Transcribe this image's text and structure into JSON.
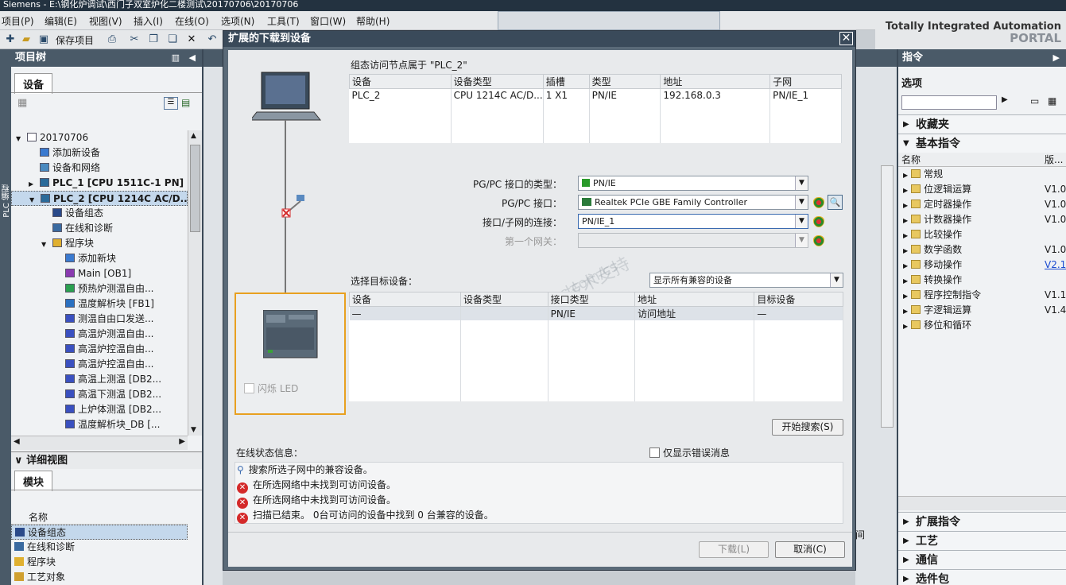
{
  "window": {
    "title": "Siemens - E:\\钢化炉调试\\西门子双室炉化二楼测试\\20170706\\20170706"
  },
  "menu": [
    "项目(P)",
    "编辑(E)",
    "视图(V)",
    "插入(I)",
    "在线(O)",
    "选项(N)",
    "工具(T)",
    "窗口(W)",
    "帮助(H)"
  ],
  "toolbar": {
    "save_label": "保存项目"
  },
  "brand": {
    "line1": "Totally Integrated Automation",
    "line2": "PORTAL"
  },
  "left": {
    "vertical_tab": "PLC 编程",
    "header": "项目树",
    "devices_tab": "设备",
    "tree": [
      {
        "label": "20170706",
        "indent": 0,
        "arrow": "▼",
        "icon": "doc"
      },
      {
        "label": "添加新设备",
        "indent": 1,
        "arrow": "",
        "icon": "add"
      },
      {
        "label": "设备和网络",
        "indent": 1,
        "arrow": "",
        "icon": "net"
      },
      {
        "label": "PLC_1 [CPU 1511C-1 PN]",
        "indent": 1,
        "arrow": "▶",
        "icon": "plc",
        "bold": true
      },
      {
        "label": "PLC_2 [CPU 1214C AC/D...",
        "indent": 1,
        "arrow": "▼",
        "icon": "plc",
        "bold": true,
        "selected": true
      },
      {
        "label": "设备组态",
        "indent": 2,
        "arrow": "",
        "icon": "cfg"
      },
      {
        "label": "在线和诊断",
        "indent": 2,
        "arrow": "",
        "icon": "diag"
      },
      {
        "label": "程序块",
        "indent": 2,
        "arrow": "▼",
        "icon": "folder"
      },
      {
        "label": "添加新块",
        "indent": 3,
        "arrow": "",
        "icon": "add"
      },
      {
        "label": "Main [OB1]",
        "indent": 3,
        "arrow": "",
        "icon": "ob"
      },
      {
        "label": "预热炉测温自由...",
        "indent": 3,
        "arrow": "",
        "icon": "fc"
      },
      {
        "label": "温度解析块 [FB1]",
        "indent": 3,
        "arrow": "",
        "icon": "fb"
      },
      {
        "label": "测温自由口发送...",
        "indent": 3,
        "arrow": "",
        "icon": "db"
      },
      {
        "label": "高温炉测温自由...",
        "indent": 3,
        "arrow": "",
        "icon": "db"
      },
      {
        "label": "高温炉控温自由...",
        "indent": 3,
        "arrow": "",
        "icon": "db"
      },
      {
        "label": "高温炉控温自由...",
        "indent": 3,
        "arrow": "",
        "icon": "db"
      },
      {
        "label": "高温上测温 [DB2...",
        "indent": 3,
        "arrow": "",
        "icon": "db"
      },
      {
        "label": "高温下测温 [DB2...",
        "indent": 3,
        "arrow": "",
        "icon": "db"
      },
      {
        "label": "上炉体测温 [DB2...",
        "indent": 3,
        "arrow": "",
        "icon": "db"
      },
      {
        "label": "温度解析块_DB [...",
        "indent": 3,
        "arrow": "",
        "icon": "db"
      }
    ],
    "detail_header": "详细视图",
    "module_tab": "模块",
    "detail_col": "名称",
    "detail_items": [
      "设备组态",
      "在线和诊断",
      "程序块",
      "工艺对象"
    ]
  },
  "right": {
    "header": "指令",
    "options": "选项",
    "favorites": "收藏夹",
    "basic": "基本指令",
    "col_name": "名称",
    "col_ver": "版...",
    "items": [
      {
        "label": "常规",
        "ver": ""
      },
      {
        "label": "位逻辑运算",
        "ver": "V1.0"
      },
      {
        "label": "定时器操作",
        "ver": "V1.0"
      },
      {
        "label": "计数器操作",
        "ver": "V1.0"
      },
      {
        "label": "比较操作",
        "ver": ""
      },
      {
        "label": "数学函数",
        "ver": "V1.0"
      },
      {
        "label": "移动操作",
        "ver": "V2.1"
      },
      {
        "label": "转换操作",
        "ver": ""
      },
      {
        "label": "程序控制指令",
        "ver": "V1.1"
      },
      {
        "label": "字逻辑运算",
        "ver": "V1.4"
      },
      {
        "label": "移位和循环",
        "ver": ""
      }
    ],
    "sections": [
      "扩展指令",
      "工艺",
      "通信",
      "选件包"
    ]
  },
  "dialog": {
    "title": "扩展的下载到设备",
    "node_title": "组态访问节点属于 \"PLC_2\"",
    "node_headers": [
      "设备",
      "设备类型",
      "插槽",
      "类型",
      "地址",
      "子网"
    ],
    "node_rows": [
      [
        "PLC_2",
        "CPU 1214C AC/D...",
        "1 X1",
        "PN/IE",
        "192.168.0.3",
        "PN/IE_1"
      ]
    ],
    "pgpc_type_label": "PG/PC 接口的类型：",
    "pgpc_type_value": "PN/IE",
    "pgpc_if_label": "PG/PC 接口：",
    "pgpc_if_value": "Realtek PCIe GBE Family Controller",
    "conn_label": "接口/子网的连接：",
    "conn_value": "PN/IE_1",
    "gateway_label": "第一个网关：",
    "gateway_value": "",
    "flash_led": "闪烁 LED",
    "target_label": "选择目标设备：",
    "target_filter": "显示所有兼容的设备",
    "target_headers": [
      "设备",
      "设备类型",
      "接口类型",
      "地址",
      "目标设备"
    ],
    "target_rows": [
      [
        "—",
        "",
        "PN/IE",
        "访问地址",
        "—"
      ]
    ],
    "search_button": "开始搜索(S)",
    "status_label": "在线状态信息：",
    "errors_only": "仅显示错误消息",
    "messages": [
      {
        "type": "info",
        "text": "搜索所选子网中的兼容设备。"
      },
      {
        "type": "error",
        "text": "在所选网络中未找到可访问设备。"
      },
      {
        "type": "error",
        "text": "在所选网络中未找到可访问设备。"
      },
      {
        "type": "error",
        "text": "扫描已结束。 0台可访问的设备中找到 0 台兼容的设备。"
      }
    ],
    "download_button": "下载(L)",
    "cancel_button": "取消(C)",
    "watermarks": [
      "西门子工业",
      "技术支持",
      "support.industry.siemens.com/cs"
    ]
  },
  "bg": {
    "right_of_dialog": "间"
  }
}
